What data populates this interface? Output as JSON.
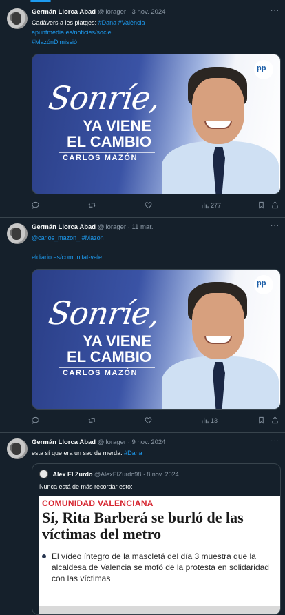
{
  "tweets": [
    {
      "author": "Germán Llorca Abad",
      "handle": "@llorager",
      "date": "3 nov. 2024",
      "text_line1": "Cadàvers a les platges:",
      "tags_line1": "#Dana #València",
      "link_line2": "apuntmedia.es/noticies/socie…",
      "tags_line3": "#MazónDimissió",
      "media": {
        "sonrie": "Sonríe,",
        "vienen_line1": "YA VIENE",
        "vienen_line2": "EL CAMBIO",
        "carlos": "CARLOS MAZÓN",
        "logo": "pp"
      },
      "views": "277"
    },
    {
      "author": "Germán Llorca Abad",
      "handle": "@llorager",
      "date": "11 mar.",
      "mentions": "@carlos_mazon_ #Mazon",
      "link": "eldiario.es/comunitat-vale…",
      "media": {
        "sonrie": "Sonríe,",
        "vienen_line1": "YA VIENE",
        "vienen_line2": "EL CAMBIO",
        "carlos": "CARLOS MAZÓN",
        "logo": "pp"
      },
      "views": "13"
    },
    {
      "author": "Germán Llorca Abad",
      "handle": "@llorager",
      "date": "9 nov. 2024",
      "text": "esta sí que era un sac de merda.",
      "tag": "#Dana",
      "quote": {
        "author": "Alex El Zurdo",
        "handle": "@AlexElZurdo98",
        "date": "8 nov. 2024",
        "text": "Nunca está de más recordar esto:",
        "kicker": "COMUNIDAD VALENCIANA",
        "headline": "Sí, Rita Barberá se burló de las víctimas del metro",
        "bullet": "El vídeo íntegro de la mascletá del día 3 muestra que la alcaldesa de Valencia se mofó de la protesta en solidaridad con las víctimas"
      }
    }
  ],
  "ui": {
    "separator": "·",
    "more": "···"
  }
}
